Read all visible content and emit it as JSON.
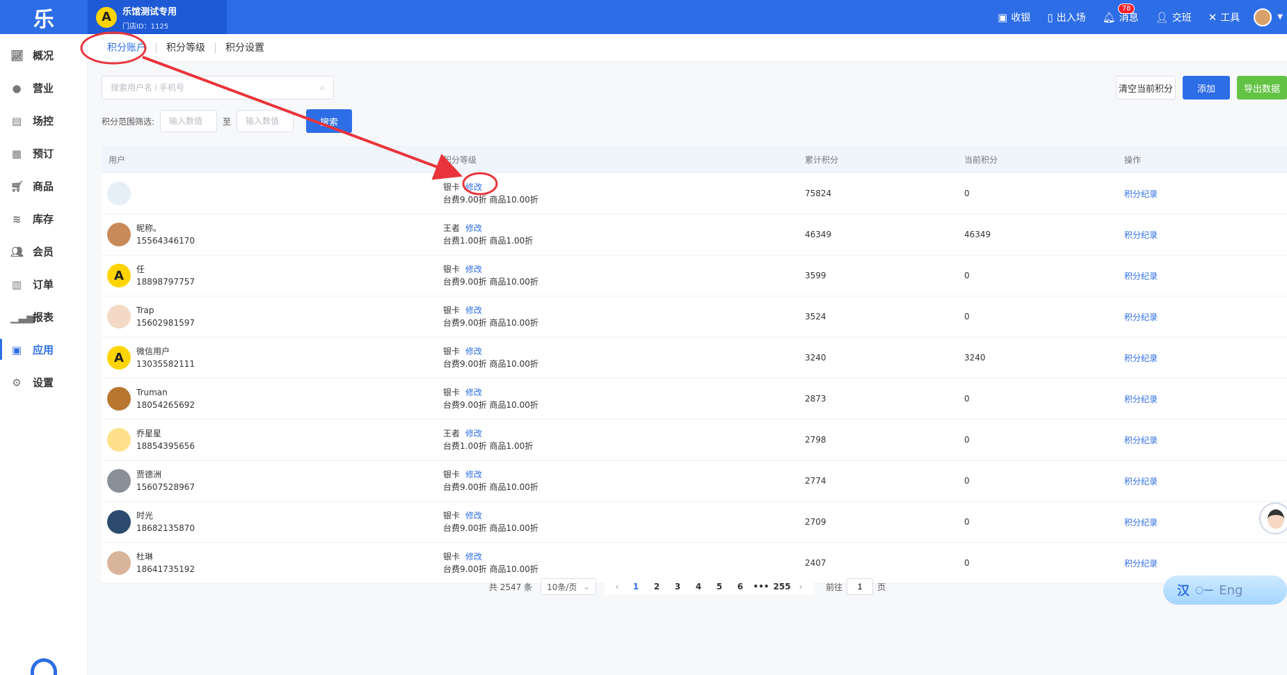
{
  "app": {
    "logo": "乐"
  },
  "store": {
    "name": "乐馆测试专用",
    "id_label": "门店ID：1125",
    "avatar_letter": "A"
  },
  "topnav": {
    "cashier": "收银",
    "entry_exit": "出入场",
    "messages": "消息",
    "messages_badge": "78",
    "shift": "交班",
    "tools": "工具"
  },
  "sidebar": {
    "items": [
      {
        "label": "概况",
        "icon": "chart-icon"
      },
      {
        "label": "营业",
        "icon": "money-bag-icon"
      },
      {
        "label": "场控",
        "icon": "venue-icon"
      },
      {
        "label": "预订",
        "icon": "calendar-icon"
      },
      {
        "label": "商品",
        "icon": "cart-icon"
      },
      {
        "label": "库存",
        "icon": "layers-icon"
      },
      {
        "label": "会员",
        "icon": "members-icon"
      },
      {
        "label": "订单",
        "icon": "order-icon"
      },
      {
        "label": "报表",
        "icon": "bar-chart-icon"
      },
      {
        "label": "应用",
        "icon": "apps-icon",
        "active": true
      },
      {
        "label": "设置",
        "icon": "gear-icon"
      }
    ]
  },
  "tabs": [
    {
      "label": "积分账户",
      "active": true
    },
    {
      "label": "积分等级"
    },
    {
      "label": "积分设置"
    }
  ],
  "filters": {
    "search_placeholder": "搜索用户名 / 手机号",
    "range_label": "积分范围筛选:",
    "range_min_placeholder": "输入数值",
    "range_to": "至",
    "range_max_placeholder": "输入数值",
    "search_button": "搜索"
  },
  "actions": {
    "clear": "清空当前积分",
    "add": "添加",
    "export": "导出数据"
  },
  "table": {
    "headers": [
      "用户",
      "积分等级",
      "累计积分",
      "当前积分",
      "操作"
    ],
    "edit_label": "修改",
    "record_label": "积分纪录",
    "rows": [
      {
        "name": "",
        "phone": "",
        "level": "银卡",
        "discount": "台费9.00折 商品10.00折",
        "total": "75824",
        "current": "0",
        "avatar_color": "#e6eef8",
        "avatar_text": ""
      },
      {
        "name": "昵称。",
        "phone": "15564346170",
        "level": "王者",
        "discount": "台费1.00折 商品1.00折",
        "total": "46349",
        "current": "46349",
        "avatar_color": "#c98a5a",
        "avatar_text": ""
      },
      {
        "name": "任",
        "phone": "18898797757",
        "level": "银卡",
        "discount": "台费9.00折 商品10.00折",
        "total": "3599",
        "current": "0",
        "avatar_color": "#ffd400",
        "avatar_text": "A"
      },
      {
        "name": "Trap",
        "phone": "15602981597",
        "level": "银卡",
        "discount": "台费9.00折 商品10.00折",
        "total": "3524",
        "current": "0",
        "avatar_color": "#f3d9c6",
        "avatar_text": ""
      },
      {
        "name": "微信用户",
        "phone": "13035582111",
        "level": "银卡",
        "discount": "台费9.00折 商品10.00折",
        "total": "3240",
        "current": "3240",
        "avatar_color": "#ffd400",
        "avatar_text": "A"
      },
      {
        "name": "Truman",
        "phone": "18054265692",
        "level": "银卡",
        "discount": "台费9.00折 商品10.00折",
        "total": "2873",
        "current": "0",
        "avatar_color": "#b8762e",
        "avatar_text": ""
      },
      {
        "name": "乔星星",
        "phone": "18854395656",
        "level": "王者",
        "discount": "台费1.00折 商品1.00折",
        "total": "2798",
        "current": "0",
        "avatar_color": "#ffe08a",
        "avatar_text": ""
      },
      {
        "name": "贾德洲",
        "phone": "15607528967",
        "level": "银卡",
        "discount": "台费9.00折 商品10.00折",
        "total": "2774",
        "current": "0",
        "avatar_color": "#8a8f99",
        "avatar_text": ""
      },
      {
        "name": "时光",
        "phone": "18682135870",
        "level": "银卡",
        "discount": "台费9.00折 商品10.00折",
        "total": "2709",
        "current": "0",
        "avatar_color": "#2b4a6e",
        "avatar_text": ""
      },
      {
        "name": "杜琳",
        "phone": "18641735192",
        "level": "银卡",
        "discount": "台费9.00折 商品10.00折",
        "total": "2407",
        "current": "0",
        "avatar_color": "#d8b49a",
        "avatar_text": ""
      }
    ]
  },
  "pagination": {
    "total": "共 2547 条",
    "page_size": "10条/页",
    "pages": [
      "1",
      "2",
      "3",
      "4",
      "5",
      "6",
      "•••",
      "255"
    ],
    "current_page": "1",
    "goto_prefix": "前往",
    "goto_value": "1",
    "goto_suffix": "页"
  },
  "lang": {
    "zh": "汉",
    "en": "Eng"
  },
  "colors": {
    "brand": "#2d6de6",
    "green": "#62c244",
    "annotation": "#e8343a"
  }
}
